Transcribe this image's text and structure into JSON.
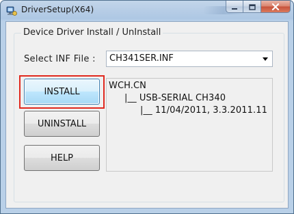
{
  "window": {
    "title": "DriverSetup(X64)"
  },
  "group": {
    "label": "Device Driver Install / UnInstall"
  },
  "inf": {
    "label": "Select INF File :",
    "selected": "CH341SER.INF"
  },
  "buttons": {
    "install": "INSTALL",
    "uninstall": "UNINSTALL",
    "help": "HELP"
  },
  "info": {
    "line1": "WCH.CN",
    "line2": "|__ USB-SERIAL CH340",
    "line3": "|__ 11/04/2011, 3.3.2011.11"
  },
  "colors": {
    "highlight": "#e0281e",
    "title_bar": "#b7cde6"
  },
  "icons": {
    "app": "setup-computer-icon",
    "minimize": "minimize-icon",
    "maximize": "maximize-icon",
    "close": "close-icon",
    "dropdown": "chevron-down-icon"
  }
}
